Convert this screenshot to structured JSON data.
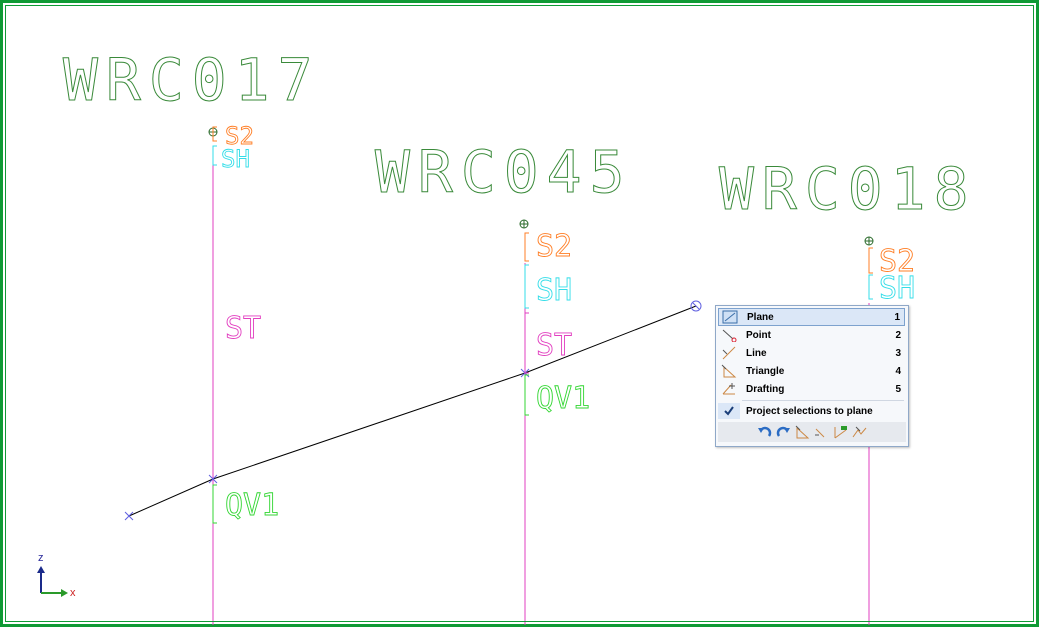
{
  "scene": {
    "labels": {
      "wrc017": "WRC017",
      "wrc045": "WRC045",
      "wrc018": "WRC018",
      "s2": "S2",
      "sh": "SH",
      "st": "ST",
      "qv1": "QV1"
    },
    "axes": {
      "z": "z",
      "x": "x"
    },
    "colors": {
      "title": "#3a8a3a",
      "s2": "#ff7f27",
      "sh": "#33dde8",
      "st": "#e23fc0",
      "qv1": "#33d633",
      "pole": "#e23fc0",
      "wire": "#000000",
      "frame": "#0f9a35"
    }
  },
  "context_menu": {
    "items": [
      {
        "label": "Plane",
        "key": "1",
        "icon": "plane-icon",
        "selected": true
      },
      {
        "label": "Point",
        "key": "2",
        "icon": "point-icon"
      },
      {
        "label": "Line",
        "key": "3",
        "icon": "line-icon"
      },
      {
        "label": "Triangle",
        "key": "4",
        "icon": "triangle-icon"
      },
      {
        "label": "Drafting",
        "key": "5",
        "icon": "drafting-icon"
      }
    ],
    "project_option": {
      "label": "Project selections to plane",
      "checked": true
    },
    "toolbar": [
      "undo-icon",
      "redo-icon",
      "plane-from-points-icon",
      "point-on-line-icon",
      "snap-icon",
      "cross-icon"
    ]
  }
}
